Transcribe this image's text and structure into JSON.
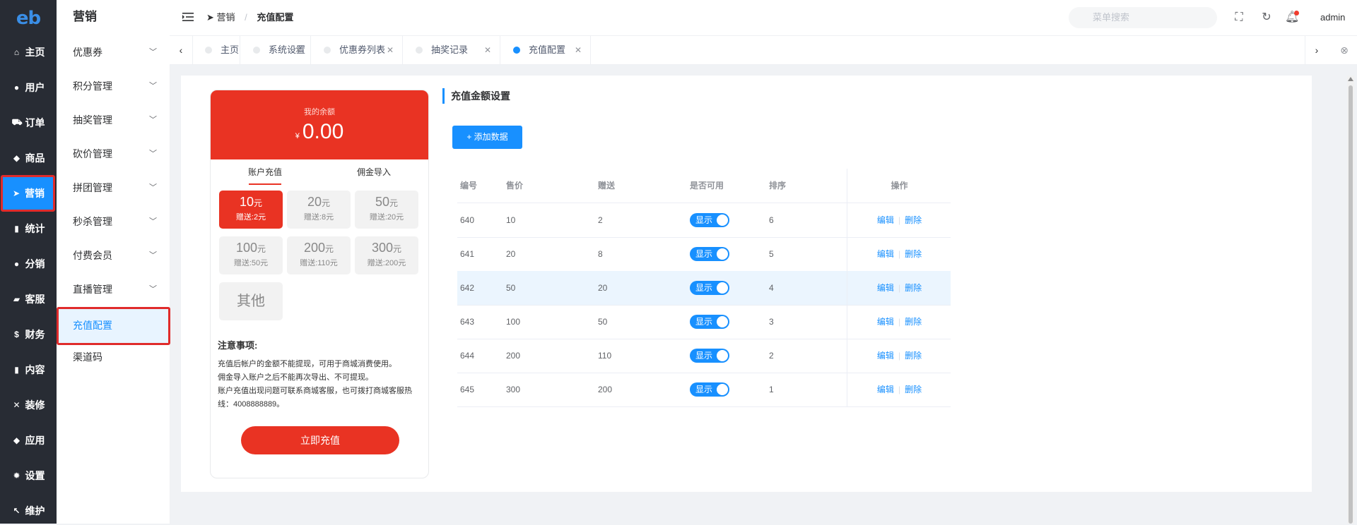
{
  "nav": {
    "logo": "eb",
    "items": [
      {
        "label": "主页",
        "icon": "home-icon",
        "glyph": "⌂"
      },
      {
        "label": "用户",
        "icon": "user-icon",
        "glyph": "●"
      },
      {
        "label": "订单",
        "icon": "cart-icon",
        "glyph": "⛟"
      },
      {
        "label": "商品",
        "icon": "basket-icon",
        "glyph": "◆"
      },
      {
        "label": "营销",
        "icon": "send-icon",
        "glyph": "➤"
      },
      {
        "label": "统计",
        "icon": "bar-chart-icon",
        "glyph": "▮"
      },
      {
        "label": "分销",
        "icon": "group-icon",
        "glyph": "●"
      },
      {
        "label": "客服",
        "icon": "chat-icon",
        "glyph": "▰"
      },
      {
        "label": "财务",
        "icon": "dollar-icon",
        "glyph": "$"
      },
      {
        "label": "内容",
        "icon": "book-icon",
        "glyph": "▮"
      },
      {
        "label": "装修",
        "icon": "tools-icon",
        "glyph": "✕"
      },
      {
        "label": "应用",
        "icon": "cube-icon",
        "glyph": "◆"
      },
      {
        "label": "设置",
        "icon": "gear-icon",
        "glyph": "✹"
      },
      {
        "label": "维护",
        "icon": "wrench-icon",
        "glyph": "↖"
      }
    ]
  },
  "submenu": {
    "title": "营销",
    "items": [
      {
        "label": "优惠券",
        "expand": true
      },
      {
        "label": "积分管理",
        "expand": true
      },
      {
        "label": "抽奖管理",
        "expand": true
      },
      {
        "label": "砍价管理",
        "expand": true
      },
      {
        "label": "拼团管理",
        "expand": true
      },
      {
        "label": "秒杀管理",
        "expand": true
      },
      {
        "label": "付费会员",
        "expand": true
      },
      {
        "label": "直播管理",
        "expand": true
      },
      {
        "label": "充值配置",
        "expand": false
      },
      {
        "label": "渠道码",
        "expand": false
      }
    ]
  },
  "header": {
    "breadcrumb_root": "营销",
    "breadcrumb_current": "充值配置",
    "search_placeholder": "菜单搜索",
    "user": "admin"
  },
  "tabs": [
    "主页",
    "系统设置",
    "优惠券列表",
    "抽奖记录",
    "充值配置"
  ],
  "preview": {
    "balance_label": "我的余额",
    "currency": "¥",
    "balance": "0.00",
    "tab_recharge": "账户充值",
    "tab_commission": "佣金导入",
    "unit": "元",
    "chips": [
      {
        "value": "10",
        "gift": "赠送:2元"
      },
      {
        "value": "20",
        "gift": "赠送:8元"
      },
      {
        "value": "50",
        "gift": "赠送:20元"
      },
      {
        "value": "100",
        "gift": "赠送:50元"
      },
      {
        "value": "200",
        "gift": "赠送:110元"
      },
      {
        "value": "300",
        "gift": "赠送:200元"
      }
    ],
    "other": "其他",
    "notes_title": "注意事项:",
    "notes": [
      "充值后帐户的金额不能提现，可用于商城消费使用。",
      "佣金导入账户之后不能再次导出、不可提现。",
      "账户充值出现问题可联系商城客服，也可拨打商城客服热线：4008888889。"
    ],
    "pay_button": "立即充值"
  },
  "main": {
    "section_title": "充值金额设置",
    "add_button": "+ 添加数据",
    "columns": [
      "编号",
      "售价",
      "赠送",
      "是否可用",
      "排序",
      "操作"
    ],
    "switch_label": "显示",
    "edit": "编辑",
    "delete": "删除",
    "rows": [
      {
        "id": "640",
        "price": "10",
        "gift": "2",
        "sort": "6"
      },
      {
        "id": "641",
        "price": "20",
        "gift": "8",
        "sort": "5"
      },
      {
        "id": "642",
        "price": "50",
        "gift": "20",
        "sort": "4"
      },
      {
        "id": "643",
        "price": "100",
        "gift": "50",
        "sort": "3"
      },
      {
        "id": "644",
        "price": "200",
        "gift": "110",
        "sort": "2"
      },
      {
        "id": "645",
        "price": "300",
        "gift": "200",
        "sort": "1"
      }
    ]
  },
  "colors": {
    "primary": "#1890ff",
    "brand_red": "#e93323",
    "nav_bg": "#282c34"
  }
}
